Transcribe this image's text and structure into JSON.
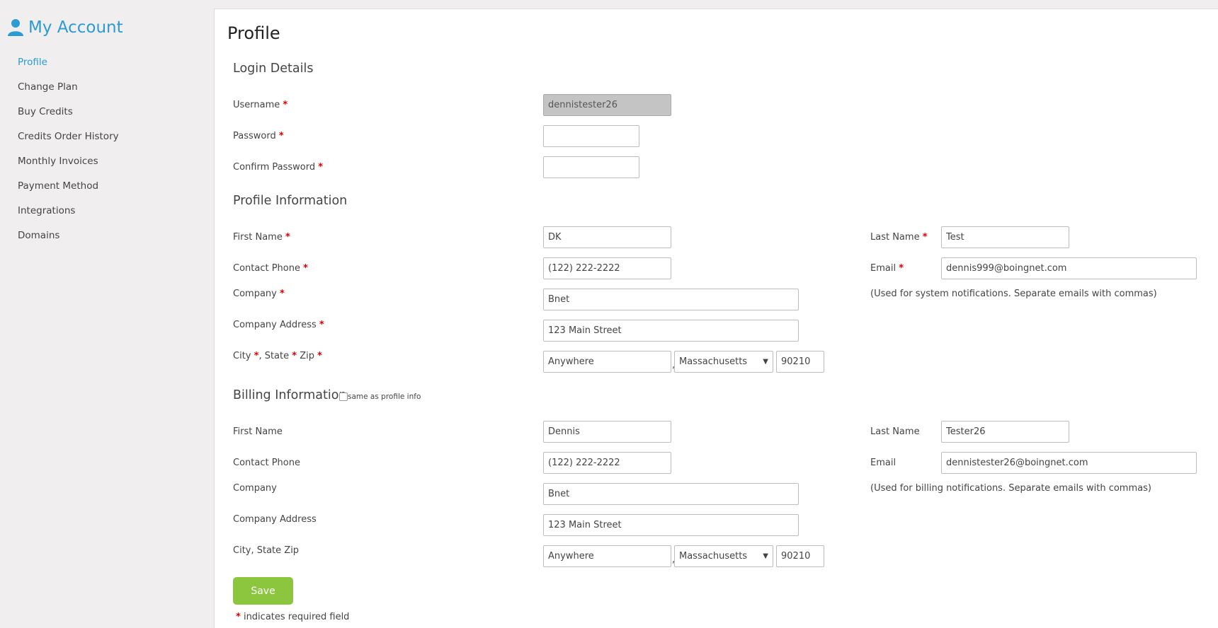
{
  "sidebar": {
    "title": "My Account",
    "items": [
      {
        "label": "Profile"
      },
      {
        "label": "Change Plan"
      },
      {
        "label": "Buy Credits"
      },
      {
        "label": "Credits Order History"
      },
      {
        "label": "Monthly Invoices"
      },
      {
        "label": "Payment Method"
      },
      {
        "label": "Integrations"
      },
      {
        "label": "Domains"
      }
    ]
  },
  "page": {
    "title": "Profile",
    "required_marker": "*",
    "footnote_text": "indicates required field",
    "save_label": "Save"
  },
  "login": {
    "title": "Login Details",
    "username_label": "Username",
    "username_value": "dennistester26",
    "password_label": "Password",
    "password_value": "",
    "confirm_label": "Confirm Password",
    "confirm_value": ""
  },
  "profile": {
    "title": "Profile Information",
    "first_name_label": "First Name",
    "first_name_value": "DK",
    "last_name_label": "Last Name",
    "last_name_value": "Test",
    "phone_label": "Contact Phone",
    "phone_value": "(122) 222-2222",
    "email_label": "Email",
    "email_value": "dennis999@boingnet.com",
    "email_note": "(Used for system notifications. Separate emails with commas)",
    "company_label": "Company",
    "company_value": "Bnet",
    "address_label": "Company Address",
    "address_value": "123 Main Street",
    "city_label": "City",
    "state_label": ", State",
    "zip_label": "Zip",
    "city_value": "Anywhere",
    "state_value": "Massachusetts",
    "zip_value": "90210"
  },
  "billing": {
    "title": "Billing Information",
    "same_label": "same as profile info",
    "first_name_label": "First Name",
    "first_name_value": "Dennis",
    "last_name_label": "Last Name",
    "last_name_value": "Tester26",
    "phone_label": "Contact Phone",
    "phone_value": "(122) 222-2222",
    "email_label": "Email",
    "email_value": "dennistester26@boingnet.com",
    "email_note": "(Used for billing notifications. Separate emails with commas)",
    "company_label": "Company",
    "company_value": "Bnet",
    "address_label": "Company Address",
    "address_value": "123 Main Street",
    "city_state_zip_label": "City, State Zip",
    "city_value": "Anywhere",
    "state_value": "Massachusetts",
    "zip_value": "90210"
  },
  "colors": {
    "accent": "#2b9bd3",
    "save_button": "#8cc63e",
    "required": "#dd0000"
  },
  "icons": {
    "account": "user-icon",
    "select_caret": "caret-down-icon"
  }
}
